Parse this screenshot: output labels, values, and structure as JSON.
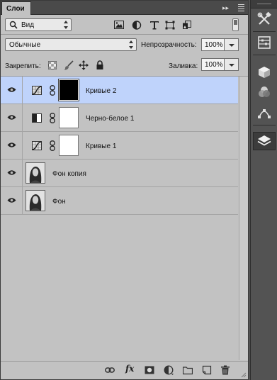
{
  "panel": {
    "tab_label": "Слои",
    "collapse_symbol": "▸▸"
  },
  "filter": {
    "kind_label": "Вид",
    "kind_icon": "search-icon"
  },
  "blend": {
    "mode": "Обычные",
    "opacity_label": "Непрозрачность:",
    "opacity_value": "100%"
  },
  "lock": {
    "label": "Закрепить:",
    "fill_label": "Заливка:",
    "fill_value": "100%"
  },
  "layers": [
    {
      "name": "Кривые 2",
      "type": "curves-adjustment",
      "mask": "black",
      "visible": true,
      "selected": true
    },
    {
      "name": "Черно-белое 1",
      "type": "black-white-adjustment",
      "mask": "white",
      "visible": true,
      "selected": false
    },
    {
      "name": "Кривые 1",
      "type": "curves-adjustment",
      "mask": "white",
      "visible": true,
      "selected": false
    },
    {
      "name": "Фон копия",
      "type": "photo",
      "visible": true,
      "selected": false
    },
    {
      "name": "Фон",
      "type": "photo",
      "visible": true,
      "selected": false
    }
  ],
  "bottom_toolbar": {
    "fx_label": "fx"
  },
  "dock": {
    "items": [
      "tools-icon",
      "properties-icon",
      "3d-icon",
      "channels-icon",
      "paths-icon",
      "layers-icon"
    ],
    "active": "layers-icon"
  },
  "colors": {
    "panel_bg": "#c2c2c2",
    "selected_row": "#bfd3fb",
    "dock_bg": "#535353"
  }
}
